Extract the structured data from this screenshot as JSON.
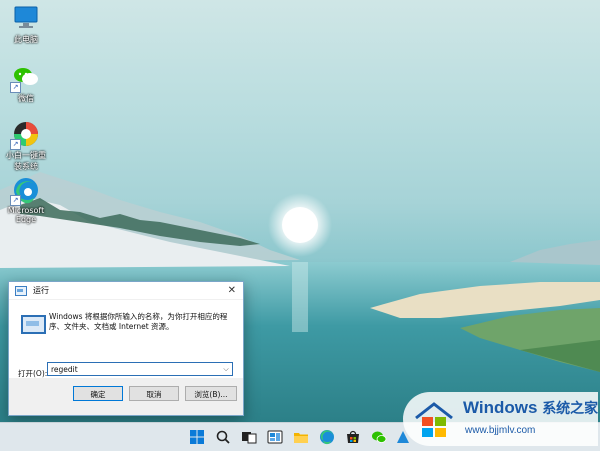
{
  "desktop": {
    "icons": [
      {
        "label": "此电脑",
        "icon": "this-pc-icon"
      },
      {
        "label": "微信",
        "icon": "wechat-icon"
      },
      {
        "label": "小白一键重装系统",
        "icon": "xiaobai-reinstall-icon"
      },
      {
        "label": "Microsoft Edge",
        "icon": "edge-icon"
      }
    ]
  },
  "run_dialog": {
    "title": "运行",
    "close_label": "✕",
    "description": "Windows 将根据你所输入的名称，为你打开相应的程序、文件夹、文档或 Internet 资源。",
    "open_label": "打开(O):",
    "input_value": "regedit",
    "ok_label": "确定",
    "cancel_label": "取消",
    "browse_label": "浏览(B)..."
  },
  "taskbar": {
    "items": [
      "start-icon",
      "search-icon",
      "task-view-icon",
      "widgets-icon",
      "file-explorer-icon",
      "edge-icon",
      "store-icon",
      "wechat-icon",
      "app-icon"
    ]
  },
  "watermark": {
    "main": "Windows",
    "cn": "系统之家",
    "url": "www.bjjmlv.com"
  },
  "colors": {
    "accent": "#0078d7",
    "watermark_blue": "#1b5aa8"
  }
}
